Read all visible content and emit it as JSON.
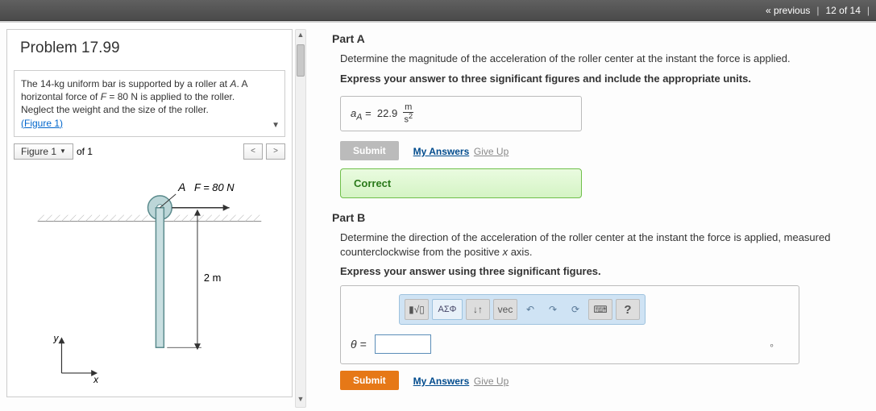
{
  "nav": {
    "previous": "« previous",
    "position": "12 of 14"
  },
  "problem": {
    "title": "Problem 17.99",
    "desc_1": "The 14-kg uniform bar is supported by a roller at ",
    "desc_A": "A",
    "desc_2": ". A horizontal force of ",
    "desc_F": "F",
    "desc_3": " = 80 N is applied to the roller. Neglect the weight and the size of the roller.",
    "fig_link": "(Figure 1)"
  },
  "figbar": {
    "label": "Figure 1",
    "of": "of 1",
    "prev": "<",
    "next": ">"
  },
  "figure": {
    "A_label": "A",
    "F_label": "F = 80 N",
    "length": "2 m",
    "y": "y",
    "x": "x"
  },
  "partA": {
    "heading": "Part A",
    "q": "Determine the magnitude of the acceleration of the roller center at the instant the force is applied.",
    "instr": "Express your answer to three significant figures and include the appropriate units.",
    "var": "a",
    "sub": "A",
    "eq": " = ",
    "val": "22.9",
    "unit_n": "m",
    "unit_d": "s",
    "unit_exp": "2",
    "submit": "Submit",
    "my_answers": "My Answers",
    "giveup": "Give Up",
    "correct": "Correct"
  },
  "partB": {
    "heading": "Part B",
    "q1": "Determine the direction of the acceleration of the roller center at the instant the force is applied, measured counterclockwise from the positive ",
    "q_x": "x",
    "q2": " axis.",
    "instr": "Express your answer using three significant figures.",
    "theta": "θ =",
    "deg": "∘",
    "submit": "Submit",
    "my_answers": "My Answers",
    "giveup": "Give Up",
    "tb": {
      "tpl": "▮√▯",
      "greek": "ΑΣΦ",
      "arrows": "↓↑",
      "vec": "vec",
      "undo": "↶",
      "redo": "↷",
      "reset": "⟳",
      "kbd": "⌨",
      "help": "?"
    }
  }
}
